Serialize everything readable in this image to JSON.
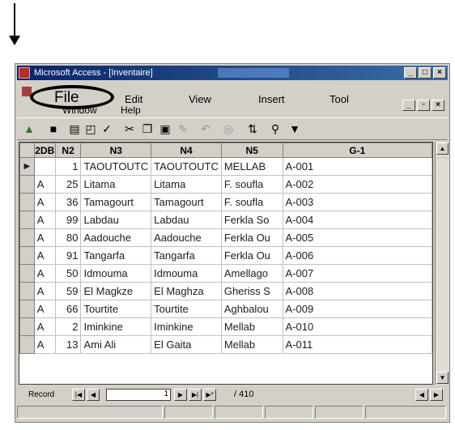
{
  "window": {
    "title": "Microsoft Access - [Inventaire]"
  },
  "menu": {
    "file": "File",
    "edit": "Edit",
    "view": "View",
    "insert": "Insert",
    "tool": "Tool",
    "window": "Window",
    "help": "Help"
  },
  "table": {
    "columns": [
      "2DB",
      "N2",
      "N3",
      "N4",
      "N5",
      "G-1"
    ],
    "rows": [
      [
        "",
        "1",
        "TAOUTOUTC",
        "TAOUTOUTC",
        "MELLAB",
        "A-001"
      ],
      [
        "A",
        "25",
        "Litama",
        "Litama",
        "F. soufla",
        "A-002"
      ],
      [
        "A",
        "36",
        "Tamagourt",
        "Tamagourt",
        "F. soufla",
        "A-003"
      ],
      [
        "A",
        "99",
        "Labdau",
        "Labdau",
        "Ferkla So",
        "A-004"
      ],
      [
        "A",
        "80",
        "Aadouche",
        "Aadouche",
        "Ferkla Ou",
        "A-005"
      ],
      [
        "A",
        "91",
        "Tangarfa",
        "Tangarfa",
        "Ferkla Ou",
        "A-006"
      ],
      [
        "A",
        "50",
        "Idmouma",
        "Idmouma",
        "Amellago",
        "A-007"
      ],
      [
        "A",
        "59",
        "El Magkze",
        "El Maghza",
        "Gheriss S",
        "A-008"
      ],
      [
        "A",
        "66",
        "Tourtite",
        "Tourtite",
        "Aghbalou",
        "A-009"
      ],
      [
        "A",
        "2",
        "Iminkine",
        "Iminkine",
        "Mellab",
        "A-010"
      ],
      [
        "A",
        "13",
        "Ami Ali",
        "El Gaita",
        "Mellab",
        "A-011"
      ]
    ]
  },
  "nav": {
    "record_label": "Record",
    "current": "1",
    "total_text": "/ 410"
  },
  "icons": {
    "pointer_arrow": "down-arrow-icon",
    "record_selector": "current-record-icon"
  }
}
